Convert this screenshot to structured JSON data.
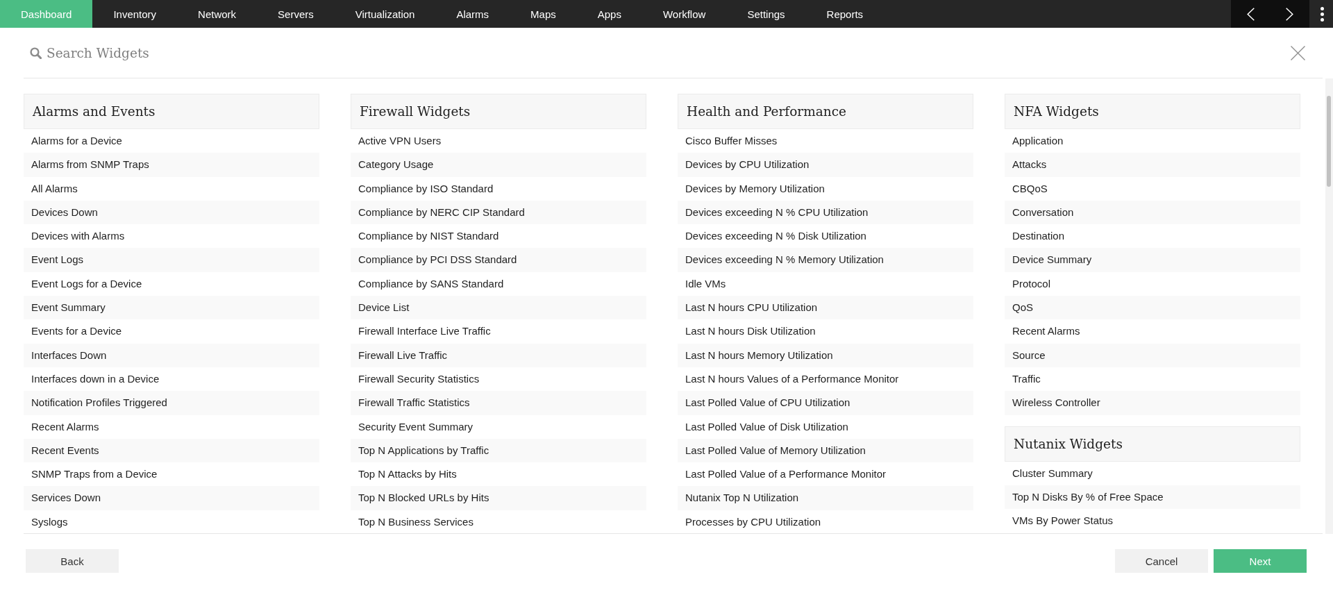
{
  "nav": {
    "tabs": [
      {
        "label": "Dashboard",
        "selected": true
      },
      {
        "label": "Inventory",
        "selected": false
      },
      {
        "label": "Network",
        "selected": false
      },
      {
        "label": "Servers",
        "selected": false
      },
      {
        "label": "Virtualization",
        "selected": false
      },
      {
        "label": "Alarms",
        "selected": false
      },
      {
        "label": "Maps",
        "selected": false
      },
      {
        "label": "Apps",
        "selected": false
      },
      {
        "label": "Workflow",
        "selected": false
      },
      {
        "label": "Settings",
        "selected": false
      },
      {
        "label": "Reports",
        "selected": false
      }
    ]
  },
  "search": {
    "placeholder": "Search Widgets"
  },
  "columns": [
    {
      "sections": [
        {
          "title": "Alarms and Events",
          "items": [
            "Alarms for a Device",
            "Alarms from SNMP Traps",
            "All Alarms",
            "Devices Down",
            "Devices with Alarms",
            "Event Logs",
            "Event Logs for a Device",
            "Event Summary",
            "Events for a Device",
            "Interfaces Down",
            "Interfaces down in a Device",
            "Notification Profiles Triggered",
            "Recent Alarms",
            "Recent Events",
            "SNMP Traps from a Device",
            "Services Down",
            "Syslogs"
          ]
        }
      ]
    },
    {
      "sections": [
        {
          "title": "Firewall Widgets",
          "items": [
            "Active VPN Users",
            "Category Usage",
            "Compliance by ISO Standard",
            "Compliance by NERC CIP Standard",
            "Compliance by NIST Standard",
            "Compliance by PCI DSS Standard",
            "Compliance by SANS Standard",
            "Device List",
            "Firewall Interface Live Traffic",
            "Firewall Live Traffic",
            "Firewall Security Statistics",
            "Firewall Traffic Statistics",
            "Security Event Summary",
            "Top N Applications by Traffic",
            "Top N Attacks by Hits",
            "Top N Blocked URLs by Hits",
            "Top N Business Services"
          ]
        }
      ]
    },
    {
      "sections": [
        {
          "title": "Health and Performance",
          "items": [
            "Cisco Buffer Misses",
            "Devices by CPU Utilization",
            "Devices by Memory Utilization",
            "Devices exceeding N % CPU Utilization",
            "Devices exceeding N % Disk Utilization",
            "Devices exceeding N % Memory Utilization",
            "Idle VMs",
            "Last N hours CPU Utilization",
            "Last N hours Disk Utilization",
            "Last N hours Memory Utilization",
            "Last N hours Values of a Performance Monitor",
            "Last Polled Value of CPU Utilization",
            "Last Polled Value of Disk Utilization",
            "Last Polled Value of Memory Utilization",
            "Last Polled Value of a Performance Monitor",
            "Nutanix Top N Utilization",
            "Processes by CPU Utilization"
          ]
        }
      ]
    },
    {
      "sections": [
        {
          "title": "NFA Widgets",
          "items": [
            "Application",
            "Attacks",
            "CBQoS",
            "Conversation",
            "Destination",
            "Device Summary",
            "Protocol",
            "QoS",
            "Recent Alarms",
            "Source",
            "Traffic",
            "Wireless Controller"
          ]
        },
        {
          "title": "Nutanix Widgets",
          "items": [
            "Cluster Summary",
            "Top N Disks By % of Free Space",
            "VMs By Power Status"
          ]
        }
      ]
    }
  ],
  "footer": {
    "left_buttons": [
      {
        "label": "Back",
        "kind": "secondary"
      }
    ],
    "right_buttons": [
      {
        "label": "Cancel",
        "kind": "secondary"
      },
      {
        "label": "Next",
        "kind": "primary"
      }
    ]
  }
}
